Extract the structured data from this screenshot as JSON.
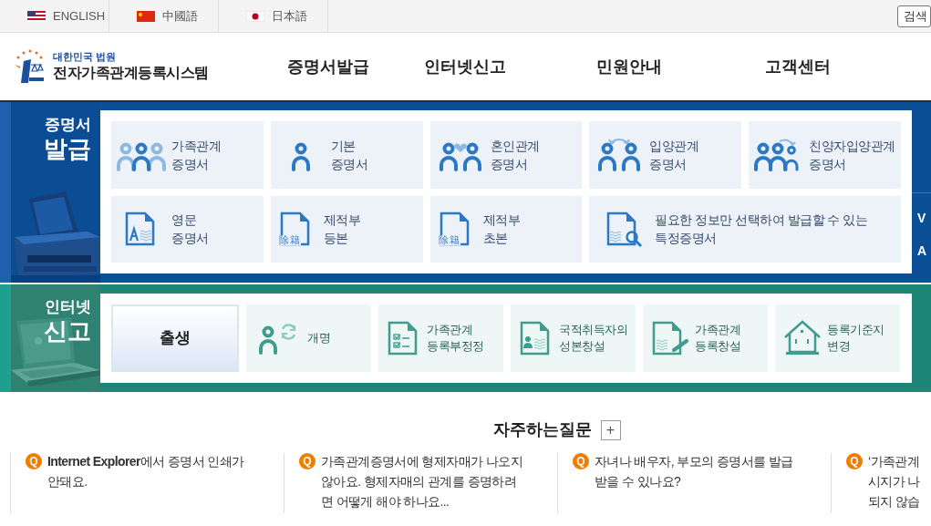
{
  "language_bar": {
    "languages": [
      {
        "label": "ENGLISH"
      },
      {
        "label": "中國語"
      },
      {
        "label": "日本語"
      }
    ],
    "search_button": "검색"
  },
  "header": {
    "logo": {
      "subtitle": "대한민국 법원",
      "title": "전자가족관계등록시스템"
    },
    "nav": [
      "증명서발급",
      "인터넷신고",
      "민원안내",
      "고객센터"
    ]
  },
  "certificates": {
    "heading_small": "증명서",
    "heading_large": "발급",
    "tiles": [
      {
        "lines": [
          "가족관계",
          "증명서"
        ]
      },
      {
        "lines": [
          "기본",
          "증명서"
        ]
      },
      {
        "lines": [
          "혼인관계",
          "증명서"
        ]
      },
      {
        "lines": [
          "입양관계",
          "증명서"
        ]
      },
      {
        "lines": [
          "친양자입양관계",
          "증명서"
        ]
      },
      {
        "lines": [
          "영문",
          "증명서"
        ]
      },
      {
        "lines": [
          "제적부",
          "등본"
        ],
        "icon_text": "除籍"
      },
      {
        "lines": [
          "제적부",
          "초본"
        ],
        "icon_text": "除籍"
      },
      {
        "lines": [
          "필요한 정보만 선택하여 발급할 수 있는",
          "특정증명서"
        ]
      }
    ],
    "side_letters": [
      "V",
      "A"
    ]
  },
  "reports": {
    "heading_small": "인터넷",
    "heading_large": "신고",
    "tiles": [
      {
        "lines": [
          "출생"
        ],
        "selected": true
      },
      {
        "lines": [
          "개명"
        ],
        "selected": false
      },
      {
        "lines": [
          "가족관계",
          "등록부정정"
        ],
        "selected": false
      },
      {
        "lines": [
          "국적취득자의",
          "성본창설"
        ],
        "selected": false
      },
      {
        "lines": [
          "가족관계",
          "등록창설"
        ],
        "selected": false
      },
      {
        "lines": [
          "등록기준지",
          "변경"
        ],
        "selected": false
      }
    ]
  },
  "faq": {
    "title": "자주하는질문",
    "more_button": "+",
    "items": [
      {
        "marker": "Q",
        "lines": [
          "**Internet Explorer**에서 증명서 인쇄가",
          "안돼요."
        ]
      },
      {
        "marker": "Q",
        "lines": [
          "가족관계증명서에 형제자매가 나오지",
          "않아요. 형제자매의 관계를 증명하려",
          "면 어떻게 해야 하나요..."
        ]
      },
      {
        "marker": "Q",
        "lines": [
          "자녀나 배우자, 부모의 증명서를 발급",
          "받을 수 있나요?"
        ]
      },
      {
        "marker": "Q",
        "lines": [
          "‘가족관계",
          "시지가 나",
          "되지 않습"
        ]
      }
    ]
  }
}
